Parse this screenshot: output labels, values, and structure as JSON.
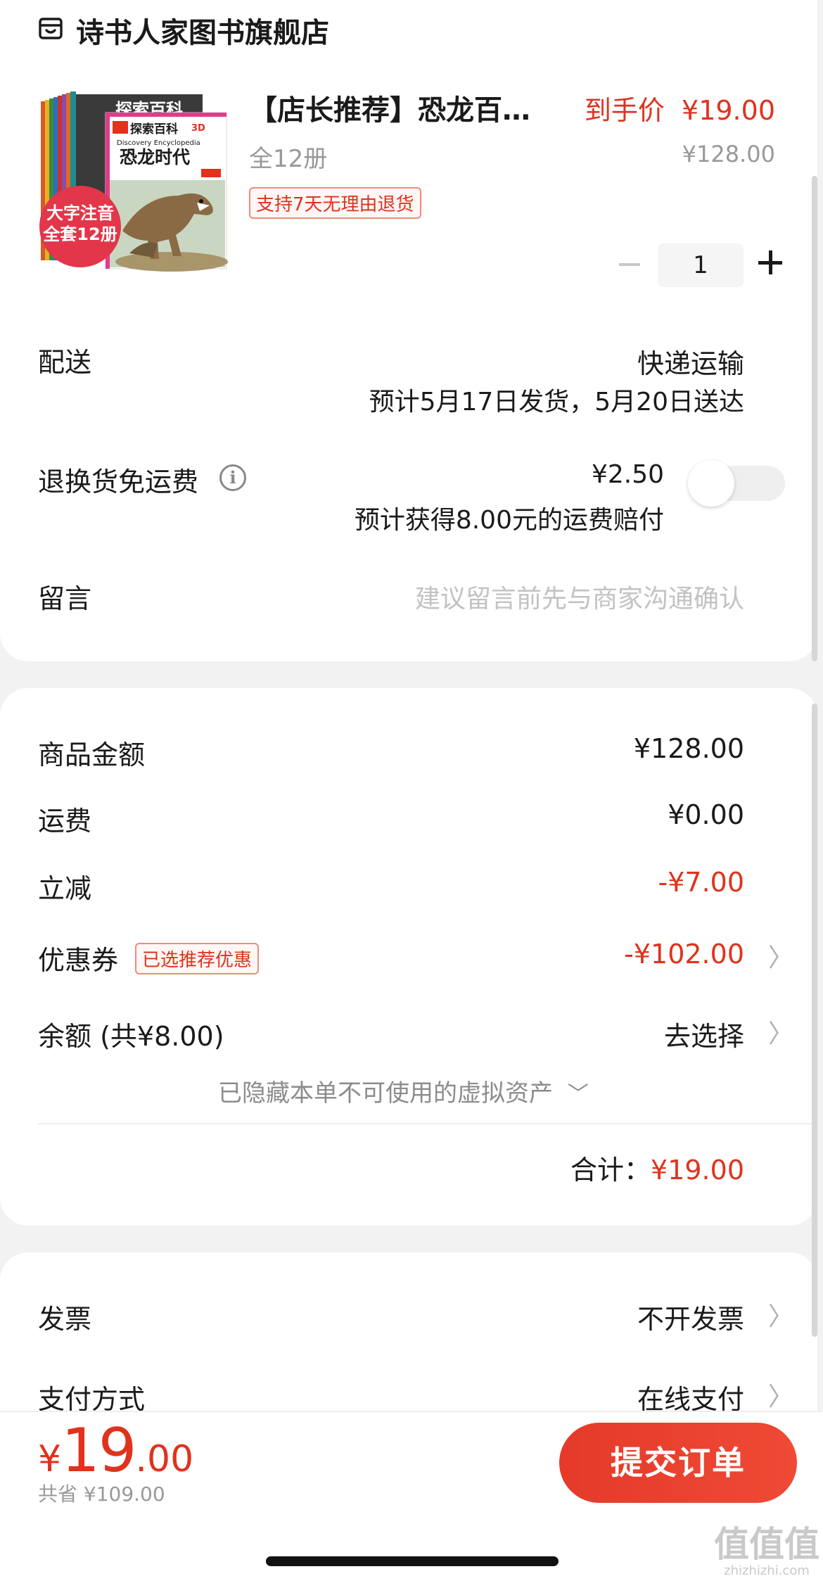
{
  "shop": {
    "name": "诗书人家图书旗舰店",
    "icon": "store-icon"
  },
  "product": {
    "title": "【店长推荐】恐龙百…",
    "final_price_label": "到手价",
    "final_price": "¥19.00",
    "spec": "全12册",
    "original_price": "¥128.00",
    "return_tag": "支持7天无理由退货",
    "quantity": "1",
    "image": {
      "badge_line1": "大字注音",
      "badge_line2": "全套12册",
      "series_label": "探索百科",
      "badge_3d": "3D",
      "subtitle_en": "Discovery Encyclopedia",
      "cover_title": "恐龙时代"
    }
  },
  "delivery": {
    "label": "配送",
    "method": "快递运输",
    "estimate": "预计5月17日发货，5月20日送达"
  },
  "return_shipping": {
    "label": "退换货免运费",
    "price": "¥2.50",
    "note": "预计获得8.00元的运费赔付",
    "enabled": false
  },
  "message": {
    "label": "留言",
    "placeholder": "建议留言前先与商家沟通确认"
  },
  "summary": {
    "goods_label": "商品金额",
    "goods_value": "¥128.00",
    "shipping_label": "运费",
    "shipping_value": "¥0.00",
    "discount_label": "立减",
    "discount_value": "-¥7.00",
    "coupon_label": "优惠券",
    "coupon_tag": "已选推荐优惠",
    "coupon_value": "-¥102.00",
    "balance_label": "余额 (共¥8.00)",
    "balance_value": "去选择",
    "hidden_assets": "已隐藏本单不可使用的虚拟资产",
    "total_label": "合计：",
    "total_value": "¥19.00"
  },
  "invoice": {
    "label": "发票",
    "value": "不开发票"
  },
  "payment": {
    "label": "支付方式",
    "value": "在线支付"
  },
  "footer": {
    "currency": "¥",
    "price_int": "19",
    "price_dec": ".00",
    "saved": "共省 ¥109.00",
    "submit": "提交订单"
  },
  "watermark": {
    "line1": "值值值",
    "line2": "zhizhizhi.com"
  },
  "colors": {
    "accent": "#e0321c",
    "button": "#e53a2a"
  }
}
